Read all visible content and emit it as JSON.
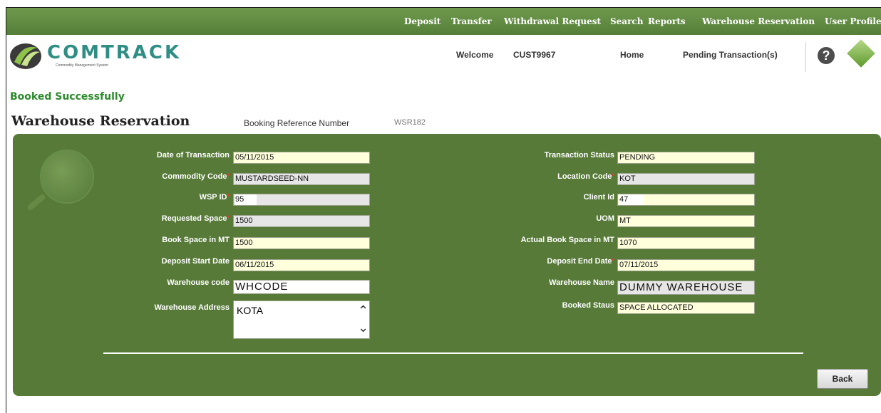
{
  "nav": [
    "Deposit",
    "Transfer",
    "Withdrawal Request",
    "Search",
    "Reports",
    "Warehouse Reservation",
    "User Profile"
  ],
  "logo": {
    "name": "COMTRACK",
    "tagline": "Commodity Management System"
  },
  "header": {
    "welcome": "Welcome",
    "user": "CUST9967",
    "home": "Home",
    "pending": "Pending Transaction(s)",
    "help_icon": "question-mark-icon",
    "badge_icon": "green-diamond-icon"
  },
  "message": "Booked Successfully",
  "page_title": "Warehouse Reservation",
  "booking_ref": {
    "label": "Booking Reference Number",
    "value": "WSR182"
  },
  "left": [
    {
      "label": "Date of Transaction",
      "value": "05/11/2015",
      "required": false
    },
    {
      "label": "Commodity Code",
      "value": "MUSTARDSEED-NN",
      "required": true
    },
    {
      "label": "WSP ID",
      "value": "95",
      "required": true
    },
    {
      "label": "Requested Space",
      "value": "1500",
      "required": true
    },
    {
      "label": "Book Space in MT",
      "value": "1500",
      "required": false
    },
    {
      "label": "Deposit Start Date",
      "value": "06/11/2015",
      "required": false
    },
    {
      "label": "Warehouse code",
      "value": "WHCODE",
      "required": false
    }
  ],
  "address": {
    "label": "Warehouse Address",
    "value": "KOTA"
  },
  "right": [
    {
      "label": "Transaction Status",
      "value": "PENDING",
      "required": false
    },
    {
      "label": "Location Code",
      "value": "KOT",
      "required": true
    },
    {
      "label": "Client Id",
      "value": "47",
      "required": false
    },
    {
      "label": "UOM",
      "value": "MT",
      "required": false
    },
    {
      "label": "Actual Book Space in MT",
      "value": "1070",
      "required": false
    },
    {
      "label": "Deposit End Date",
      "value": "07/11/2015",
      "required": true
    },
    {
      "label": "Warehouse Name",
      "value": "DUMMY WAREHOUSE",
      "required": false
    },
    {
      "label": "Booked Staus",
      "value": "SPACE ALLOCATED",
      "required": false
    }
  ],
  "back_label": "Back",
  "colors": {
    "nav": "#6f9a4d",
    "panel": "#577a39",
    "field": "#ffffdc",
    "success": "#2c8a2c"
  }
}
